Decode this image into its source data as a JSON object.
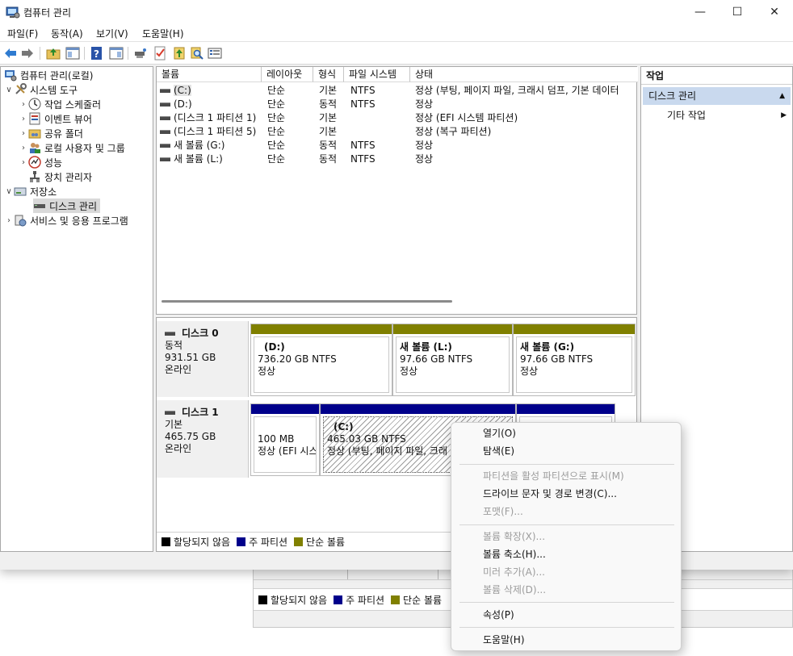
{
  "window": {
    "title": "컴퓨터 관리"
  },
  "controls": {
    "minimize": "—",
    "maximize": "☐",
    "close": "✕"
  },
  "menubar": [
    "파일(F)",
    "동작(A)",
    "보기(V)",
    "도움말(H)"
  ],
  "tree": {
    "root": "컴퓨터 관리(로컬)",
    "items": [
      "시스템 도구",
      "작업 스케줄러",
      "이벤트 뷰어",
      "공유 폴더",
      "로컬 사용자 및 그룹",
      "성능",
      "장치 관리자",
      "저장소",
      "디스크 관리",
      "서비스 및 응용 프로그램"
    ]
  },
  "volume_list": {
    "columns": [
      "볼륨",
      "레이아웃",
      "형식",
      "파일 시스템",
      "상태"
    ],
    "rows": [
      [
        "(C:)",
        "단순",
        "기본",
        "NTFS",
        "정상 (부팅, 페이지 파일, 크래시 덤프, 기본 데이터"
      ],
      [
        "(D:)",
        "단순",
        "동적",
        "NTFS",
        "정상"
      ],
      [
        "(디스크 1 파티션 1)",
        "단순",
        "기본",
        "",
        "정상 (EFI 시스템 파티션)"
      ],
      [
        "(디스크 1 파티션 5)",
        "단순",
        "기본",
        "",
        "정상 (복구 파티션)"
      ],
      [
        "새 볼륨 (G:)",
        "단순",
        "동적",
        "NTFS",
        "정상"
      ],
      [
        "새 볼륨 (L:)",
        "단순",
        "동적",
        "NTFS",
        "정상"
      ]
    ]
  },
  "disks": [
    {
      "name": "디스크 0",
      "type": "동적",
      "size": "931.51 GB",
      "status": "온라인",
      "partitions": [
        {
          "label": "(D:)",
          "size": "736.20 GB NTFS",
          "status": "정상"
        },
        {
          "label": "새 볼륨  (L:)",
          "size": "97.66 GB NTFS",
          "status": "정상"
        },
        {
          "label": "새 볼륨  (G:)",
          "size": "97.66 GB NTFS",
          "status": "정상"
        }
      ]
    },
    {
      "name": "디스크 1",
      "type": "기본",
      "size": "465.75 GB",
      "status": "온라인",
      "partitions": [
        {
          "label": "",
          "size": "100 MB",
          "status": "정상 (EFI 시스"
        },
        {
          "label": "(C:)",
          "size": "465.03 GB NTFS",
          "status": "정상 (부팅, 페이지 파일, 크래"
        }
      ]
    }
  ],
  "legend": [
    "할당되지 않음",
    "주 파티션",
    "단순 볼륨"
  ],
  "colors": {
    "unallocated": "#000000",
    "primary": "#00008b",
    "simple": "#808000",
    "selection": "#c9d9ee"
  },
  "actions": {
    "header": "작업",
    "section": "디스크 관리",
    "item": "기타 작업"
  },
  "context_menu": {
    "open": "열기(O)",
    "explore": "탐색(E)",
    "mark_active": "파티션을 활성 파티션으로 표시(M)",
    "change_letter": "드라이브 문자 및 경로 변경(C)...",
    "format": "포맷(F)...",
    "extend": "볼륨 확장(X)...",
    "shrink": "볼륨 축소(H)...",
    "add_mirror": "미러 추가(A)...",
    "delete": "볼륨 삭제(D)...",
    "properties": "속성(P)",
    "help": "도움말(H)"
  }
}
